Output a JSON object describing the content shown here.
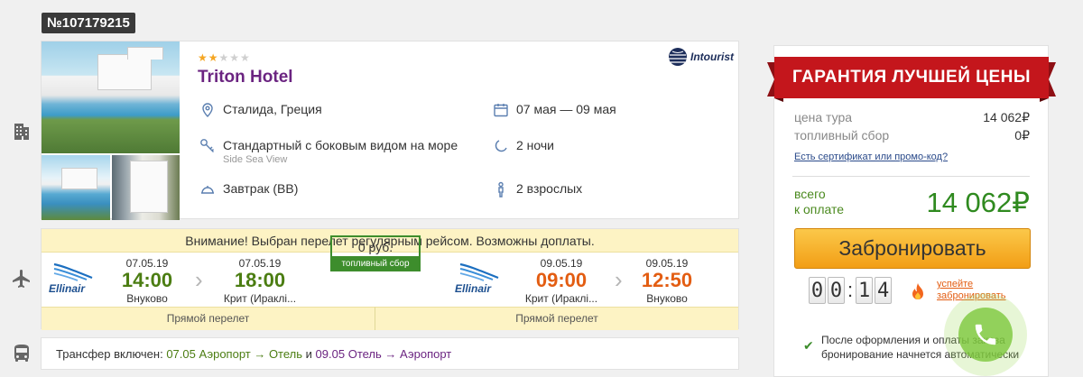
{
  "order_number": "№107179215",
  "hotel": {
    "name": "Triton Hotel",
    "stars_filled": 2,
    "stars_total": 5,
    "operator": "Intourist",
    "location": "Сталида, Греция",
    "room": "Стандартный с боковым видом на море",
    "room_sub": "Side Sea View",
    "meal": "Завтрак (BB)",
    "dates": "07 мая — 09 мая",
    "nights": "2 ночи",
    "guests": "2 взрослых"
  },
  "flight": {
    "warning": "Внимание! Выбран перелет регулярным рейсом. Возможны доплаты.",
    "outbound": {
      "airline": "Ellinair",
      "dep_date": "07.05.19",
      "dep_time": "14:00",
      "dep_place": "Внуково",
      "arr_date": "07.05.19",
      "arr_time": "18:00",
      "arr_place": "Крит (Ираклі...",
      "type": "Прямой перелет"
    },
    "fuel": {
      "value": "0 руб.",
      "label": "топливный сбор"
    },
    "inbound": {
      "airline": "Ellinair",
      "dep_date": "09.05.19",
      "dep_time": "09:00",
      "dep_place": "Крит (Ираклі...",
      "arr_date": "09.05.19",
      "arr_time": "12:50",
      "arr_place": "Внуково",
      "type": "Прямой перелет"
    }
  },
  "transfer": {
    "prefix": "Трансфер включен:",
    "date1": "07.05",
    "route1": "Аэропорт → Отель",
    "and": "и",
    "date2": "09.05",
    "route2": "Отель → Аэропорт"
  },
  "price": {
    "banner": "ГАРАНТИЯ ЛУЧШЕЙ ЦЕНЫ",
    "tour_label": "цена тура",
    "tour_value": "14 062₽",
    "fuel_label": "топливный сбор",
    "fuel_value": "0₽",
    "promo_link": "Есть сертификат или промо-код?",
    "total_label_1": "всего",
    "total_label_2": "к оплате",
    "total_value": "14 062₽",
    "book_button": "Забронировать",
    "timer": [
      "0",
      "0",
      "1",
      "4"
    ],
    "hurry_1": "успейте",
    "hurry_2": "забронировать",
    "note": "После оформления и оплаты заказа бронирование начнется автоматически"
  },
  "colors": {
    "accent_purple": "#6b2481",
    "green": "#3d8d2c",
    "orange": "#e35d12",
    "ribbon_red": "#c4161c",
    "button_orange": "#f29e15"
  }
}
